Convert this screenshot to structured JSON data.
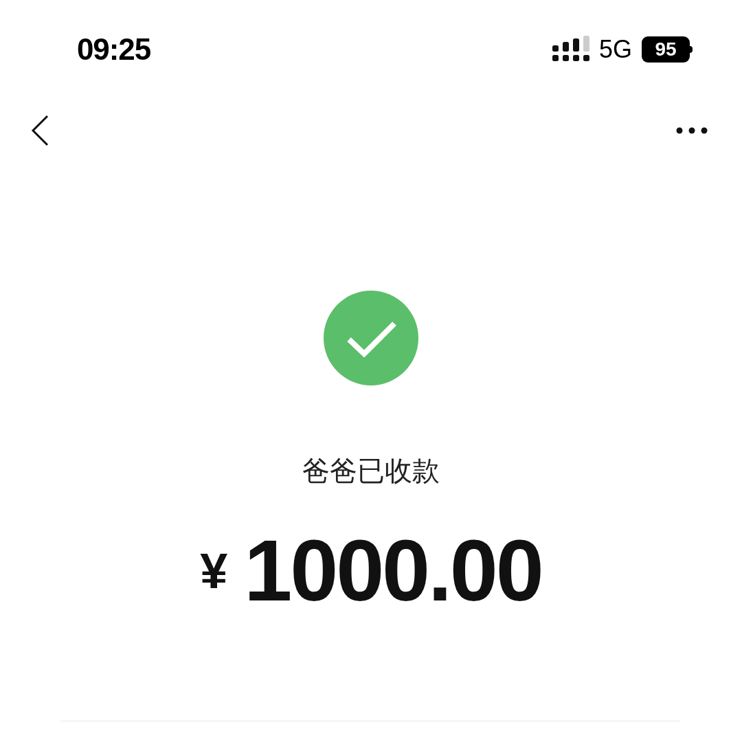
{
  "status_bar": {
    "time": "09:25",
    "network": "5G",
    "battery": "95"
  },
  "result": {
    "succeeded": true,
    "message": "爸爸已收款",
    "currency": "¥",
    "amount": "1000.00"
  }
}
